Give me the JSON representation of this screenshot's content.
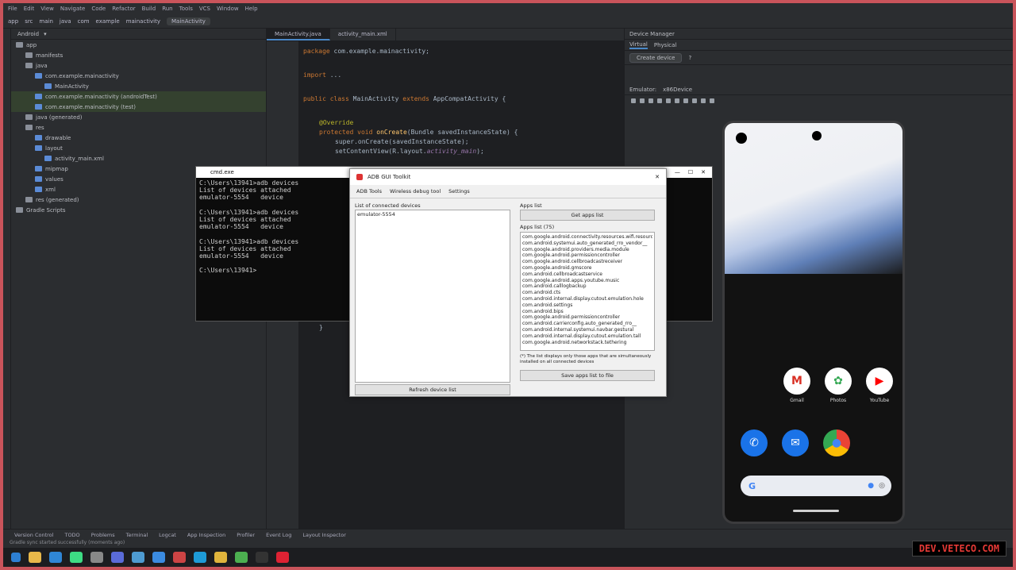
{
  "ide": {
    "menu": [
      "File",
      "Edit",
      "View",
      "Navigate",
      "Code",
      "Refactor",
      "Build",
      "Run",
      "Tools",
      "VCS",
      "Window",
      "Help"
    ],
    "toolbar_items": [
      "app",
      "src",
      "main",
      "java",
      "com",
      "example",
      "mainactivity",
      "MainActivity"
    ],
    "project_header": "Android",
    "tree": [
      {
        "label": "app",
        "indent": 0,
        "selected": false
      },
      {
        "label": "manifests",
        "indent": 1,
        "selected": false
      },
      {
        "label": "java",
        "indent": 1,
        "selected": false
      },
      {
        "label": "com.example.mainactivity",
        "indent": 2,
        "selected": false
      },
      {
        "label": "MainActivity",
        "indent": 3,
        "selected": false
      },
      {
        "label": "com.example.mainactivity (androidTest)",
        "indent": 2,
        "selected": true
      },
      {
        "label": "com.example.mainactivity (test)",
        "indent": 2,
        "selected": true
      },
      {
        "label": "java (generated)",
        "indent": 1,
        "selected": false
      },
      {
        "label": "res",
        "indent": 1,
        "selected": false
      },
      {
        "label": "drawable",
        "indent": 2,
        "selected": false
      },
      {
        "label": "layout",
        "indent": 2,
        "selected": false
      },
      {
        "label": "activity_main.xml",
        "indent": 3,
        "selected": false
      },
      {
        "label": "mipmap",
        "indent": 2,
        "selected": false
      },
      {
        "label": "values",
        "indent": 2,
        "selected": false
      },
      {
        "label": "xml",
        "indent": 2,
        "selected": false
      },
      {
        "label": "res (generated)",
        "indent": 1,
        "selected": false
      },
      {
        "label": "Gradle Scripts",
        "indent": 0,
        "selected": false
      }
    ],
    "tabs": [
      "MainActivity.java",
      "activity_main.xml"
    ],
    "code": {
      "l1_kw": "package",
      "l1_rest": " com.example.mainactivity;",
      "l2_kw": "import",
      "l2_rest": " ...",
      "l3_a": "public class ",
      "l3_b": "MainActivity ",
      "l3_c": "extends ",
      "l3_d": "AppCompatActivity {",
      "l4": "@Override",
      "l5_a": "protected void ",
      "l5_b": "onCreate",
      "l5_c": "(Bundle savedInstanceState) {",
      "l6": "super.onCreate(savedInstanceState);",
      "l7_a": "setContentView(R.layout.",
      "l7_b": "activity_main",
      "l7_c": ");",
      "l8": "}"
    },
    "device_manager": {
      "title": "Device Manager",
      "tabs": [
        "Virtual",
        "Physical"
      ],
      "create_label": "Create device",
      "help": "?",
      "emulator_label": "Emulator:",
      "emulator_device": "x86Device"
    },
    "bottom_tools": [
      "Version Control",
      "TODO",
      "Problems",
      "Terminal",
      "Logcat",
      "App Inspection",
      "Profiler",
      "Event Log",
      "Layout Inspector"
    ],
    "status_text": "Gradle sync started successfully (moments ago)"
  },
  "console": {
    "title": "cmd.exe",
    "lines": [
      "C:\\Users\\13941>adb devices",
      "List of devices attached",
      "emulator-5554   device",
      "",
      "C:\\Users\\13941>adb devices",
      "List of devices attached",
      "emulator-5554   device",
      "",
      "C:\\Users\\13941>adb devices",
      "List of devices attached",
      "emulator-5554   device",
      "",
      "C:\\Users\\13941>"
    ]
  },
  "adb": {
    "title": "ADB GUI Toolkit",
    "menu": [
      "ADB Tools",
      "Wireless debug tool",
      "Settings"
    ],
    "left_label": "List of connected devices",
    "device_item": "emulator-5554",
    "refresh_label": "Refresh device list",
    "right_label": "Apps list",
    "get_btn": "Get apps list",
    "count_label": "Apps list (75)",
    "packages": [
      "com.google.android.connectivity.resources.wifi.resource",
      "com.android.systemui.auto_generated_rro_vendor__",
      "com.google.android.providers.media.module",
      "com.google.android.permissioncontroller",
      "com.google.android.cellbroadcastreceiver",
      "com.google.android.gmscore",
      "com.android.cellbroadcastservice",
      "com.google.android.apps.youtube.music",
      "com.android.calllogbackup",
      "com.android.cts",
      "com.android.internal.display.cutout.emulation.hole",
      "com.android.settings",
      "com.android.bips",
      "com.google.android.permissioncontroller",
      "com.android.carrierconfig.auto_generated_rro__",
      "com.android.internal.systemui.navbar.gestural",
      "com.android.internal.display.cutout.emulation.tall",
      "com.google.android.networkstack.tethering"
    ],
    "note": "(*) The list displays only those apps that are simultaneously installed on all connected devices",
    "save_btn": "Save apps list to file"
  },
  "phone": {
    "apps": [
      {
        "label": "Gmail",
        "glyph": "M",
        "color": "#ffffff",
        "text": "#d93025"
      },
      {
        "label": "Photos",
        "glyph": "✿",
        "color": "#ffffff",
        "text": "#34a853"
      },
      {
        "label": "YouTube",
        "glyph": "▶",
        "color": "#ffffff",
        "text": "#ff0000"
      }
    ],
    "dock": [
      {
        "name": "phone",
        "glyph": "✆",
        "color": "#1a73e8"
      },
      {
        "name": "messages",
        "glyph": "✉",
        "color": "#1a73e8"
      },
      {
        "name": "chrome",
        "glyph": "●",
        "color": "#ffffff"
      }
    ],
    "search_glyph": "G"
  },
  "watermark": "DEV.VETECO.COM",
  "colors": {
    "accent": "#4a88c7",
    "watermark": "#e53935"
  }
}
